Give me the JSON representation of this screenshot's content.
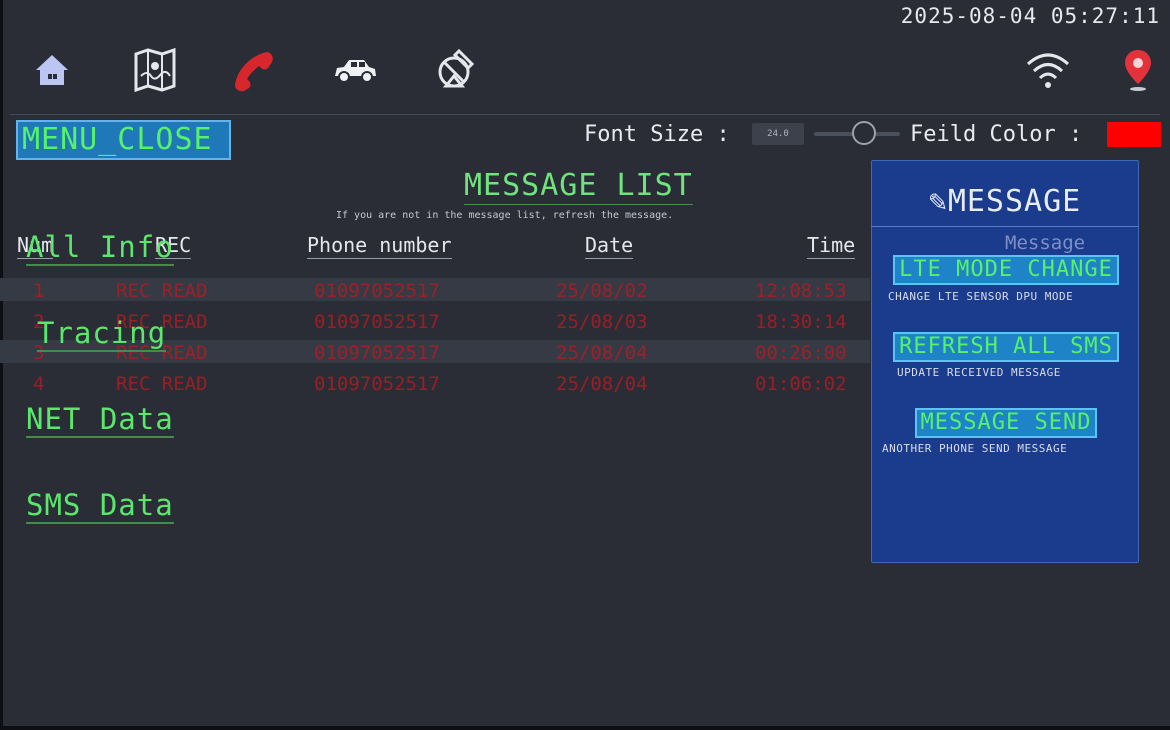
{
  "clock": "2025-08-04 05:27:11",
  "nav_icons": [
    "home-icon",
    "map-icon",
    "phone-icon",
    "car-icon",
    "satellite-icon"
  ],
  "status_icons": [
    "wifi-icon",
    "location-pin-icon"
  ],
  "menu_close_label": "MENU_CLOSE",
  "font_size": {
    "label": "Font Size :",
    "value": "24.0"
  },
  "field_color": {
    "label": "Feild Color :",
    "value": "#ff0000"
  },
  "message_list": {
    "title": "MESSAGE LIST",
    "subtitle": "If you are not in the message list, refresh the message.",
    "headers": {
      "num": "Num",
      "rec": "REC",
      "phone": "Phone number",
      "date": "Date",
      "time": "Time"
    },
    "rows": [
      {
        "num": "1",
        "rec": "REC READ",
        "phone": "01097052517",
        "date": "25/08/02",
        "time": "12:08:53"
      },
      {
        "num": "2",
        "rec": "REC READ",
        "phone": "01097052517",
        "date": "25/08/03",
        "time": "18:30:14"
      },
      {
        "num": "3",
        "rec": "REC READ",
        "phone": "01097052517",
        "date": "25/08/04",
        "time": "00:26:00"
      },
      {
        "num": "4",
        "rec": "REC READ",
        "phone": "01097052517",
        "date": "25/08/04",
        "time": "01:06:02"
      }
    ]
  },
  "side_menu": [
    "All Info",
    "Tracing",
    "NET Data",
    "SMS Data"
  ],
  "panel": {
    "title": "MESSAGE",
    "faint_label": "Message",
    "buttons": [
      {
        "label": "LTE MODE CHANGE",
        "desc": "CHANGE LTE SENSOR DPU MODE"
      },
      {
        "label": "REFRESH ALL SMS",
        "desc": "UPDATE RECEIVED MESSAGE"
      },
      {
        "label": "MESSAGE SEND",
        "desc": "ANOTHER PHONE SEND MESSAGE"
      }
    ]
  },
  "colors": {
    "background": "#2a2d36",
    "accent_green": "#55f26a",
    "row_text_red": "#b51b21",
    "panel_blue": "#1b3b8c"
  }
}
